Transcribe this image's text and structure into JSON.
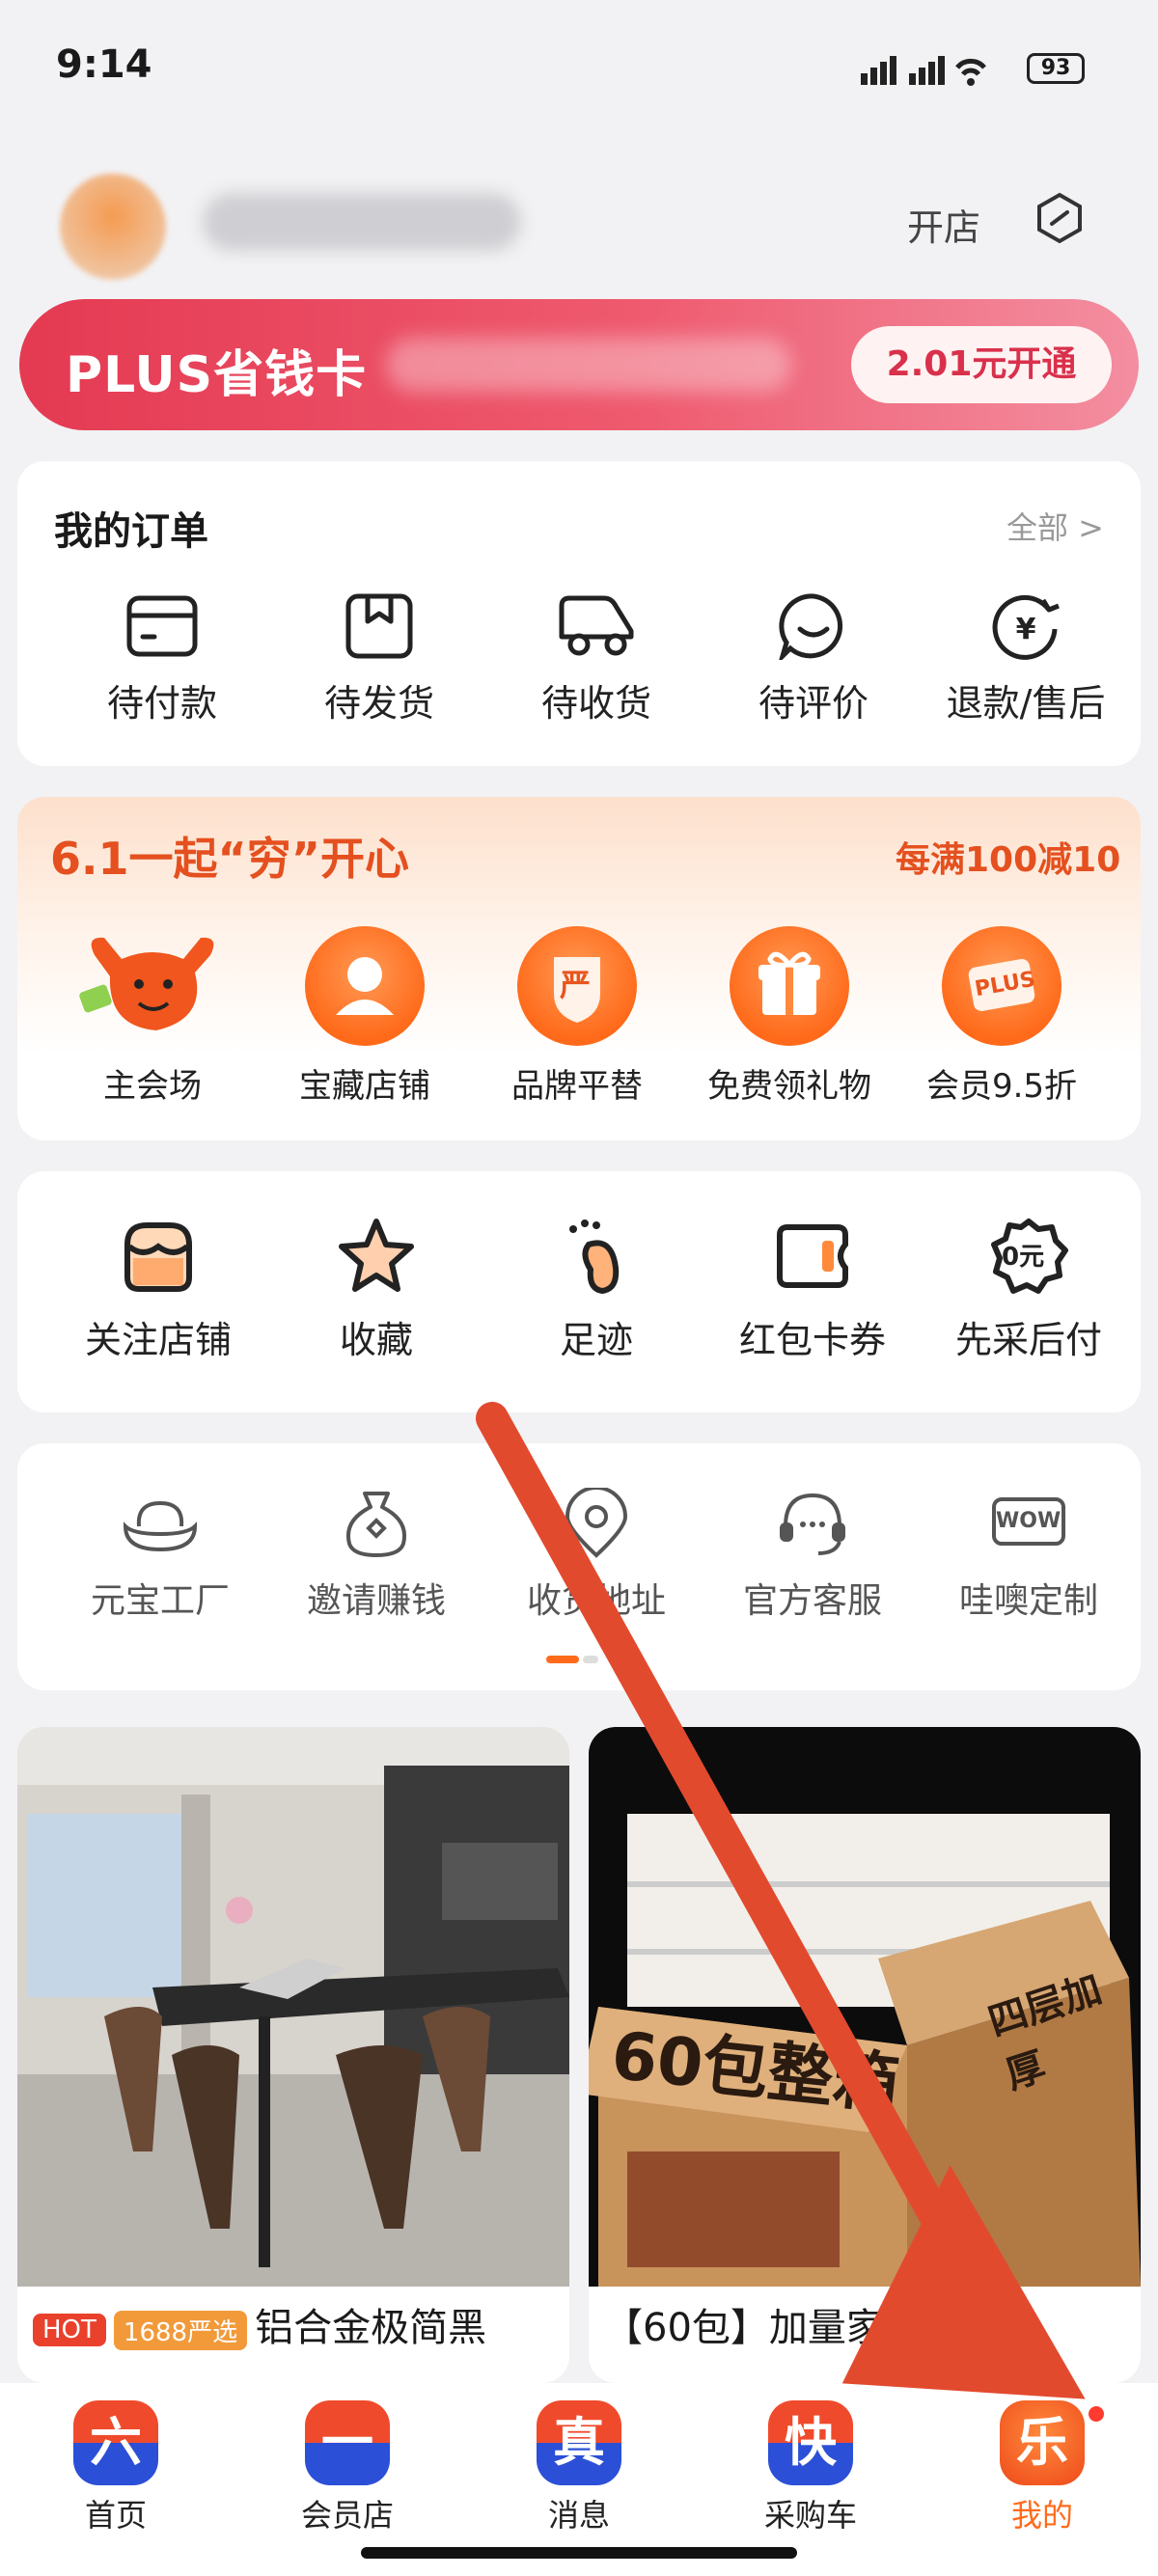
{
  "status_bar": {
    "time": "9:14",
    "battery": "93"
  },
  "header": {
    "shop_label": "开店"
  },
  "plus_banner": {
    "title": "PLUS省钱卡",
    "button": "2.01元开通"
  },
  "orders": {
    "title": "我的订单",
    "all_label": "全部 >",
    "items": [
      {
        "label": "待付款",
        "icon": "wallet-icon"
      },
      {
        "label": "待发货",
        "icon": "package-icon"
      },
      {
        "label": "待收货",
        "icon": "truck-icon"
      },
      {
        "label": "待评价",
        "icon": "smile-chat-icon"
      },
      {
        "label": "退款/售后",
        "icon": "refund-yen-icon"
      }
    ]
  },
  "promo": {
    "title": "6.1一起“穷”开心",
    "right": "每满100减10",
    "items": [
      {
        "label": "主会场",
        "icon": "bull-mascot-icon"
      },
      {
        "label": "宝藏店铺",
        "icon": "person-icon"
      },
      {
        "label": "品牌平替",
        "icon": "shield-yan-icon",
        "glyph": "严"
      },
      {
        "label": "免费领礼物",
        "icon": "gift-icon"
      },
      {
        "label": "会员9.5折",
        "icon": "plus-card-icon",
        "glyph": "PLUS"
      }
    ]
  },
  "tools": {
    "items": [
      {
        "label": "关注店铺",
        "icon": "store-icon"
      },
      {
        "label": "收藏",
        "icon": "star-icon"
      },
      {
        "label": "足迹",
        "icon": "footprint-icon"
      },
      {
        "label": "红包卡券",
        "icon": "coupon-icon"
      },
      {
        "label": "先采后付",
        "icon": "zero-yuan-icon",
        "glyph": "0元"
      }
    ]
  },
  "services": {
    "items": [
      {
        "label": "元宝工厂",
        "icon": "ingot-icon"
      },
      {
        "label": "邀请赚钱",
        "icon": "money-bag-icon"
      },
      {
        "label": "收货地址",
        "icon": "location-icon"
      },
      {
        "label": "官方客服",
        "icon": "headset-icon"
      },
      {
        "label": "哇噢定制",
        "icon": "wow-icon",
        "glyph": "WOW"
      }
    ]
  },
  "products": [
    {
      "tags": [
        {
          "text": "HOT",
          "color": "#e9412c"
        },
        {
          "text": "1688严选",
          "color": "#f29a3a"
        }
      ],
      "title": "铝合金极简黑"
    },
    {
      "tags": [],
      "title": "【60包】加量家用面",
      "image_text_1": "60包整箱",
      "image_text_2": "四层加厚"
    }
  ],
  "tabbar": {
    "tabs": [
      {
        "label": "首页",
        "glyph": "六",
        "color": "#e8412a"
      },
      {
        "label": "会员店",
        "glyph": "一",
        "color": "#e8412a"
      },
      {
        "label": "消息",
        "glyph": "真",
        "color": "#e8412a"
      },
      {
        "label": "采购车",
        "glyph": "快",
        "color": "#e8412a"
      },
      {
        "label": "我的",
        "glyph": "乐",
        "color": "#ff6a1a"
      }
    ]
  },
  "colors": {
    "accent": "#ff6a1a",
    "plus": "#e43a52",
    "arrow": "#e24a2e"
  }
}
